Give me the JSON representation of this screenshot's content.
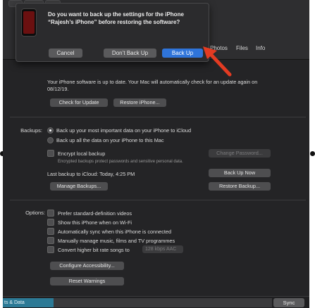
{
  "dialog": {
    "message": "Do you want to back up the settings for the iPhone “Rajesh’s iPhone” before restoring the software?",
    "cancel": "Cancel",
    "dont_backup": "Don’t Back Up",
    "backup": "Back Up"
  },
  "tabs": [
    "Photos",
    "Files",
    "Info"
  ],
  "software": {
    "status": "Your iPhone software is up to date. Your Mac will automatically check for an update again on 08/12/19.",
    "check_update": "Check for Update",
    "restore": "Restore iPhone..."
  },
  "backups": {
    "section_label": "Backups:",
    "opt_icloud": "Back up your most important data on your iPhone to iCloud",
    "opt_mac": "Back up all the data on your iPhone to this Mac",
    "encrypt": "Encrypt local backup",
    "encrypt_note": "Encrypted backups protect passwords and sensitive personal data.",
    "change_password": "Change Password...",
    "last_backup": "Last backup to iCloud: Today, 4:25 PM",
    "backup_now": "Back Up Now",
    "manage": "Manage Backups...",
    "restore_backup": "Restore Backup..."
  },
  "options": {
    "section_label": "Options:",
    "items": [
      "Prefer standard-definition videos",
      "Show this iPhone when on Wi-Fi",
      "Automatically sync when this iPhone is connected",
      "Manually manage music, films and TV programmes",
      "Convert higher bit rate songs to"
    ],
    "bitrate": "128 kbps AAC",
    "accessibility": "Configure Accessibility...",
    "reset": "Reset Warnings"
  },
  "footer": {
    "storage_label": "ts & Data",
    "sync": "Sync"
  },
  "colors": {
    "accent": "#2f74d9",
    "arrow": "#e33b22",
    "storage": "#2c7a96"
  }
}
